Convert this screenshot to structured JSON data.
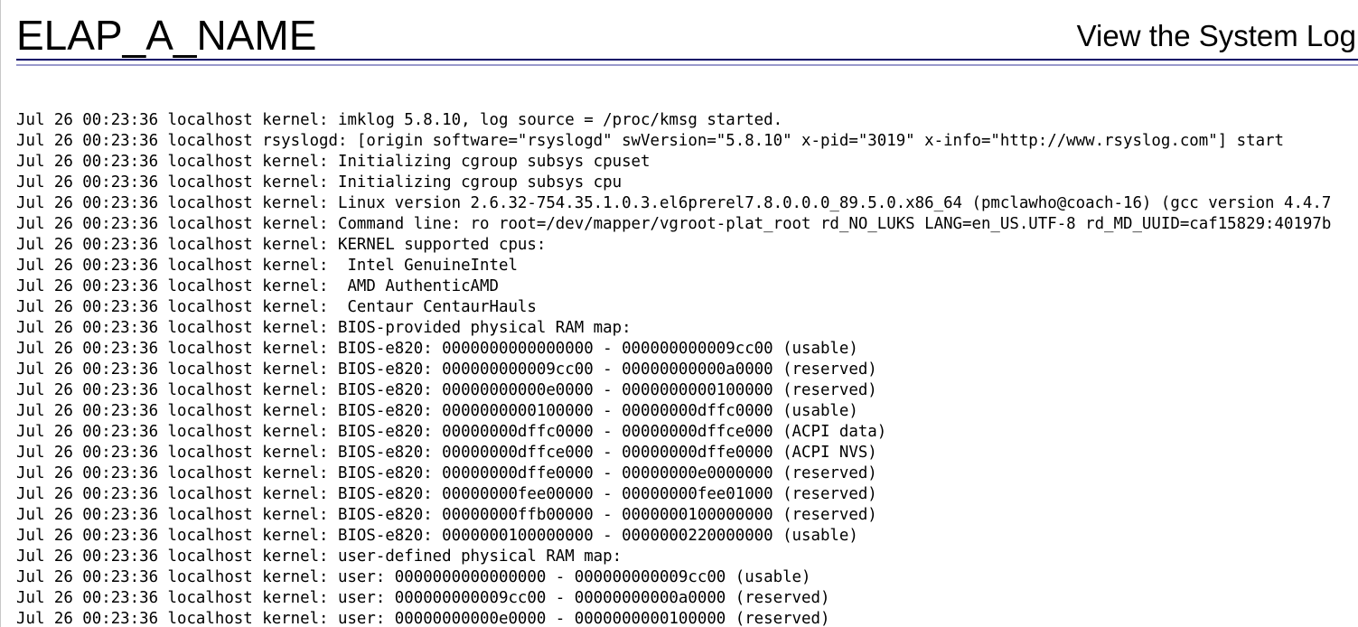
{
  "header": {
    "system_name": "ELAP_A_NAME",
    "page_title": "View the System Log"
  },
  "log": {
    "lines": [
      "Jul 26 00:23:36 localhost kernel: imklog 5.8.10, log source = /proc/kmsg started.",
      "Jul 26 00:23:36 localhost rsyslogd: [origin software=\"rsyslogd\" swVersion=\"5.8.10\" x-pid=\"3019\" x-info=\"http://www.rsyslog.com\"] start",
      "Jul 26 00:23:36 localhost kernel: Initializing cgroup subsys cpuset",
      "Jul 26 00:23:36 localhost kernel: Initializing cgroup subsys cpu",
      "Jul 26 00:23:36 localhost kernel: Linux version 2.6.32-754.35.1.0.3.el6prerel7.8.0.0.0_89.5.0.x86_64 (pmclawho@coach-16) (gcc version 4.4.7",
      "Jul 26 00:23:36 localhost kernel: Command line: ro root=/dev/mapper/vgroot-plat_root rd_NO_LUKS LANG=en_US.UTF-8 rd_MD_UUID=caf15829:40197b",
      "Jul 26 00:23:36 localhost kernel: KERNEL supported cpus:",
      "Jul 26 00:23:36 localhost kernel:  Intel GenuineIntel",
      "Jul 26 00:23:36 localhost kernel:  AMD AuthenticAMD",
      "Jul 26 00:23:36 localhost kernel:  Centaur CentaurHauls",
      "Jul 26 00:23:36 localhost kernel: BIOS-provided physical RAM map:",
      "Jul 26 00:23:36 localhost kernel: BIOS-e820: 0000000000000000 - 000000000009cc00 (usable)",
      "Jul 26 00:23:36 localhost kernel: BIOS-e820: 000000000009cc00 - 00000000000a0000 (reserved)",
      "Jul 26 00:23:36 localhost kernel: BIOS-e820: 00000000000e0000 - 0000000000100000 (reserved)",
      "Jul 26 00:23:36 localhost kernel: BIOS-e820: 0000000000100000 - 00000000dffc0000 (usable)",
      "Jul 26 00:23:36 localhost kernel: BIOS-e820: 00000000dffc0000 - 00000000dffce000 (ACPI data)",
      "Jul 26 00:23:36 localhost kernel: BIOS-e820: 00000000dffce000 - 00000000dffe0000 (ACPI NVS)",
      "Jul 26 00:23:36 localhost kernel: BIOS-e820: 00000000dffe0000 - 00000000e0000000 (reserved)",
      "Jul 26 00:23:36 localhost kernel: BIOS-e820: 00000000fee00000 - 00000000fee01000 (reserved)",
      "Jul 26 00:23:36 localhost kernel: BIOS-e820: 00000000ffb00000 - 0000000100000000 (reserved)",
      "Jul 26 00:23:36 localhost kernel: BIOS-e820: 0000000100000000 - 0000000220000000 (usable)",
      "Jul 26 00:23:36 localhost kernel: user-defined physical RAM map:",
      "Jul 26 00:23:36 localhost kernel: user: 0000000000000000 - 000000000009cc00 (usable)",
      "Jul 26 00:23:36 localhost kernel: user: 000000000009cc00 - 00000000000a0000 (reserved)",
      "Jul 26 00:23:36 localhost kernel: user: 00000000000e0000 - 0000000000100000 (reserved)"
    ]
  }
}
